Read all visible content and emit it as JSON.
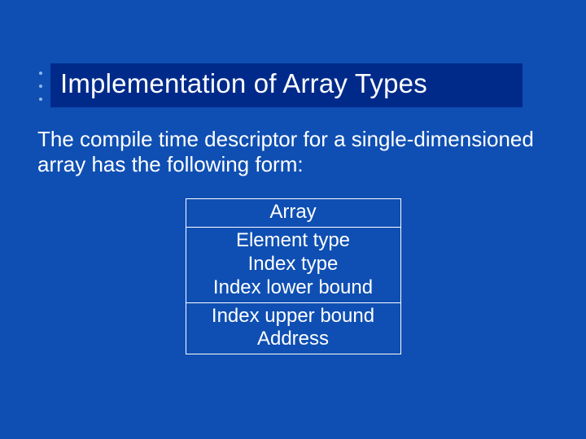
{
  "title": "Implementation of Array Types",
  "body": "The compile time descriptor for a single-dimensioned array has the following form:",
  "table": {
    "row0": "Array",
    "row1_line1": "Element type",
    "row1_line2": "Index type",
    "row1_line3": "Index lower bound",
    "row2_line1": "Index upper bound",
    "row2_line2": "Address"
  }
}
